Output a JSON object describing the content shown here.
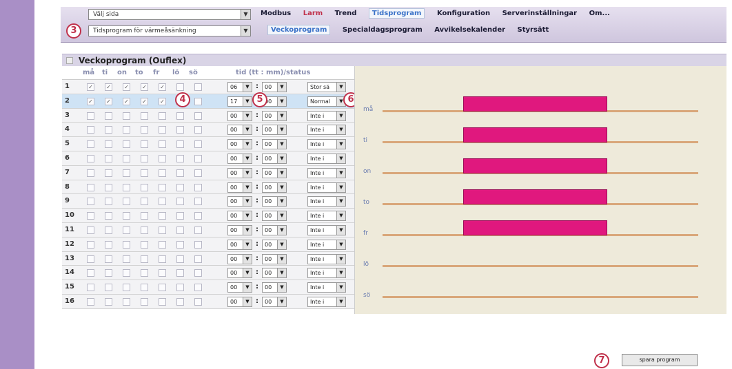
{
  "nav": {
    "page_select": "Välj sida",
    "program_select": "Tidsprogram för värmeåsänkning",
    "menu": [
      "Modbus",
      "Larm",
      "Trend",
      "Tidsprogram",
      "Konfiguration",
      "Serverinställningar",
      "Om..."
    ],
    "submenu": [
      "Veckoprogram",
      "Specialdagsprogram",
      "Avvikelsekalender",
      "Styrsätt"
    ]
  },
  "markers": {
    "m3": "3",
    "m4": "4",
    "m5": "5",
    "m6": "6",
    "m7": "7"
  },
  "panel": {
    "title": "Veckoprogram (Ouflex)"
  },
  "columns": {
    "days": [
      "må",
      "ti",
      "on",
      "to",
      "fr",
      "lö",
      "sö"
    ],
    "time": "tid (tt : mm)/status"
  },
  "rows": [
    {
      "n": "1",
      "checked": [
        1,
        1,
        1,
        1,
        1,
        0,
        0
      ],
      "hh": "06",
      "mm": "00",
      "status": "Stor sä"
    },
    {
      "n": "2",
      "checked": [
        1,
        1,
        1,
        1,
        1,
        0,
        0
      ],
      "hh": "17",
      "mm": "00",
      "status": "Normal"
    },
    {
      "n": "3",
      "checked": [
        0,
        0,
        0,
        0,
        0,
        0,
        0
      ],
      "hh": "00",
      "mm": "00",
      "status": "Inte i"
    },
    {
      "n": "4",
      "checked": [
        0,
        0,
        0,
        0,
        0,
        0,
        0
      ],
      "hh": "00",
      "mm": "00",
      "status": "Inte i"
    },
    {
      "n": "5",
      "checked": [
        0,
        0,
        0,
        0,
        0,
        0,
        0
      ],
      "hh": "00",
      "mm": "00",
      "status": "Inte i"
    },
    {
      "n": "6",
      "checked": [
        0,
        0,
        0,
        0,
        0,
        0,
        0
      ],
      "hh": "00",
      "mm": "00",
      "status": "Inte i"
    },
    {
      "n": "7",
      "checked": [
        0,
        0,
        0,
        0,
        0,
        0,
        0
      ],
      "hh": "00",
      "mm": "00",
      "status": "Inte i"
    },
    {
      "n": "8",
      "checked": [
        0,
        0,
        0,
        0,
        0,
        0,
        0
      ],
      "hh": "00",
      "mm": "00",
      "status": "Inte i"
    },
    {
      "n": "9",
      "checked": [
        0,
        0,
        0,
        0,
        0,
        0,
        0
      ],
      "hh": "00",
      "mm": "00",
      "status": "Inte i"
    },
    {
      "n": "10",
      "checked": [
        0,
        0,
        0,
        0,
        0,
        0,
        0
      ],
      "hh": "00",
      "mm": "00",
      "status": "Inte i"
    },
    {
      "n": "11",
      "checked": [
        0,
        0,
        0,
        0,
        0,
        0,
        0
      ],
      "hh": "00",
      "mm": "00",
      "status": "Inte i"
    },
    {
      "n": "12",
      "checked": [
        0,
        0,
        0,
        0,
        0,
        0,
        0
      ],
      "hh": "00",
      "mm": "00",
      "status": "Inte i"
    },
    {
      "n": "13",
      "checked": [
        0,
        0,
        0,
        0,
        0,
        0,
        0
      ],
      "hh": "00",
      "mm": "00",
      "status": "Inte i"
    },
    {
      "n": "14",
      "checked": [
        0,
        0,
        0,
        0,
        0,
        0,
        0
      ],
      "hh": "00",
      "mm": "00",
      "status": "Inte i"
    },
    {
      "n": "15",
      "checked": [
        0,
        0,
        0,
        0,
        0,
        0,
        0
      ],
      "hh": "00",
      "mm": "00",
      "status": "Inte i"
    },
    {
      "n": "16",
      "checked": [
        0,
        0,
        0,
        0,
        0,
        0,
        0
      ],
      "hh": "00",
      "mm": "00",
      "status": "Inte i"
    }
  ],
  "schedule": [
    {
      "day": "må",
      "start": "06:00",
      "end": "17:00"
    },
    {
      "day": "ti",
      "start": "06:00",
      "end": "17:00"
    },
    {
      "day": "on",
      "start": "06:00",
      "end": "17:00"
    },
    {
      "day": "to",
      "start": "06:00",
      "end": "17:00"
    },
    {
      "day": "fr",
      "start": "06:00",
      "end": "17:00"
    },
    {
      "day": "lö",
      "start": null,
      "end": null
    },
    {
      "day": "sö",
      "start": null,
      "end": null
    }
  ],
  "save_button": "spara program",
  "colors": {
    "accent": "#e0187e",
    "line": "#d9a77a",
    "active_menu": "#3a72c8"
  }
}
